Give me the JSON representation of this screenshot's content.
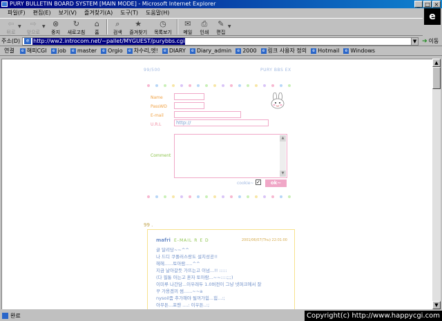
{
  "window": {
    "title": "PURY BULLETIN BOARD SYSTEM [MAIN MODE] - Microsoft Internet Explorer",
    "controls": [
      "_",
      "□",
      "×"
    ]
  },
  "menu": [
    "파일(F)",
    "편집(E)",
    "보기(V)",
    "즐겨찾기(A)",
    "도구(T)",
    "도움말(H)"
  ],
  "toolbar": {
    "back": "뒤로",
    "forward": "앞으로",
    "stop": "중지",
    "refresh": "새로고침",
    "home": "홈",
    "search": "검색",
    "favorites": "즐겨찾기",
    "history": "목록보기",
    "mail": "메일",
    "print": "인쇄",
    "edit": "편집"
  },
  "address": {
    "label": "주소(D)",
    "url": "http://ww2.introcom.net/~pallet/MYGUEST/purybbs.cgi",
    "go": "이동"
  },
  "links": {
    "label": "연결",
    "items": [
      "해피CGI",
      "job",
      "master",
      "Orgio",
      "차수리,엣!",
      "DIARY",
      "Diary_admin",
      "2000",
      "링크 사용자 정의",
      "Hotmail",
      "Windows"
    ]
  },
  "status": {
    "text": "완료",
    "copyright": "Copyright(c) http://www.happycgi.com"
  },
  "page": {
    "counter": "99/500",
    "bbs_title": "PURY BBS EX",
    "form": {
      "name_label": "Name",
      "password_label": "PassWD",
      "email_label": "E-mail",
      "url_label": "U.R.L",
      "url_value": "http://",
      "comment_label": "Comment",
      "cookie_label": "cookie~",
      "cookie_checked": "✓",
      "ok_label": "ok~"
    },
    "post": {
      "number": "99 .",
      "author": "mafri",
      "actions": "E-MAIL  R  E  D",
      "date": "2001/06/07(Thu) 22:01:00",
      "lines": [
        "글 달리당~~^^",
        "나 드디 쿠폴러스랑도 설치성공!!",
        "헤헤......토아람.....^^",
        "지금 날아갈듯 가뜨는고 이넘...!! :::::",
        "(다 필통 아는고 혼자 토아람...~~::::;;;)",
        "이미루 나간담...이우래두 1.0버전이 그냥 넷퍼크에서 잘",
        "꾸 가용겠끼 썸......~~a",
        "nysoil좀 추가해야 될꺼가힘...힘...:;",
        "아무튼...포맨 ....: 이우튼..:;"
      ]
    },
    "dot_colors": [
      "#f7b7d0",
      "#b7d6f7",
      "#c9f0b7",
      "#f7e6a6",
      "#d9c4f7"
    ]
  }
}
